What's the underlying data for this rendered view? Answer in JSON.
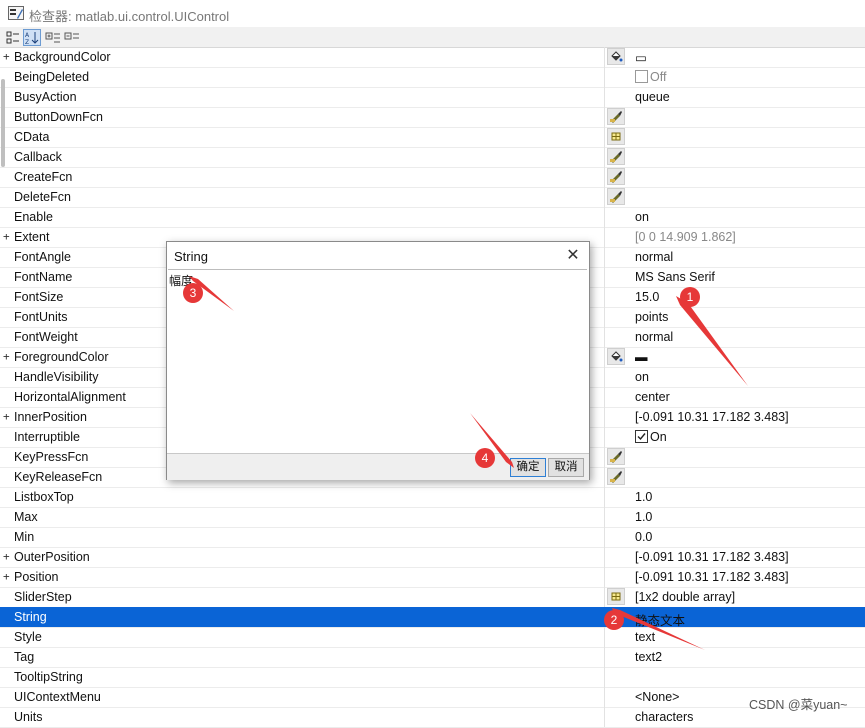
{
  "window": {
    "title": "检查器: matlab.ui.control.UIControl"
  },
  "colors": {
    "selection": "#0a64d6",
    "annotation": "#e63838"
  },
  "properties": [
    {
      "name": "BackgroundColor",
      "expandable": true,
      "button": "color-fill-icon",
      "value": "▭"
    },
    {
      "name": "BeingDeleted",
      "checkbox": false,
      "value": "Off",
      "gray": true
    },
    {
      "name": "BusyAction",
      "value": "queue"
    },
    {
      "name": "ButtonDownFcn",
      "button": "callback-edit-icon",
      "value": ""
    },
    {
      "name": "CData",
      "button": "array-edit-icon",
      "value": ""
    },
    {
      "name": "Callback",
      "button": "callback-edit-icon",
      "value": ""
    },
    {
      "name": "CreateFcn",
      "button": "callback-edit-icon",
      "value": ""
    },
    {
      "name": "DeleteFcn",
      "button": "callback-edit-icon",
      "value": ""
    },
    {
      "name": "Enable",
      "value": "on"
    },
    {
      "name": "Extent",
      "expandable": true,
      "value": "[0 0 14.909 1.862]",
      "gray": true
    },
    {
      "name": "FontAngle",
      "value": "normal"
    },
    {
      "name": "FontName",
      "value": "MS Sans Serif"
    },
    {
      "name": "FontSize",
      "value": "15.0"
    },
    {
      "name": "FontUnits",
      "value": "points"
    },
    {
      "name": "FontWeight",
      "value": "normal"
    },
    {
      "name": "ForegroundColor",
      "expandable": true,
      "button": "color-fill-icon",
      "value": "▬"
    },
    {
      "name": "HandleVisibility",
      "value": "on"
    },
    {
      "name": "HorizontalAlignment",
      "value": "center"
    },
    {
      "name": "InnerPosition",
      "expandable": true,
      "value": "[-0.091 10.31 17.182 3.483]"
    },
    {
      "name": "Interruptible",
      "checkbox": true,
      "value": "On"
    },
    {
      "name": "KeyPressFcn",
      "button": "callback-edit-icon",
      "value": ""
    },
    {
      "name": "KeyReleaseFcn",
      "button": "callback-edit-icon",
      "value": ""
    },
    {
      "name": "ListboxTop",
      "value": "1.0"
    },
    {
      "name": "Max",
      "value": "1.0"
    },
    {
      "name": "Min",
      "value": "0.0"
    },
    {
      "name": "OuterPosition",
      "expandable": true,
      "value": "[-0.091 10.31 17.182 3.483]"
    },
    {
      "name": "Position",
      "expandable": true,
      "value": "[-0.091 10.31 17.182 3.483]"
    },
    {
      "name": "SliderStep",
      "button": "array-edit-icon",
      "value": "[1x2  double array]"
    },
    {
      "name": "String",
      "selected": true,
      "value": "静态文本"
    },
    {
      "name": "Style",
      "value": "text"
    },
    {
      "name": "Tag",
      "value": "text2"
    },
    {
      "name": "TooltipString",
      "value": ""
    },
    {
      "name": "UIContextMenu",
      "value": "<None>"
    },
    {
      "name": "Units",
      "value": "characters"
    }
  ],
  "dialog": {
    "title": "String",
    "text": "幅度",
    "ok_label": "确定",
    "cancel_label": "取消"
  },
  "annotations": [
    "1",
    "2",
    "3",
    "4"
  ],
  "watermark": "CSDN @菜yuan~"
}
